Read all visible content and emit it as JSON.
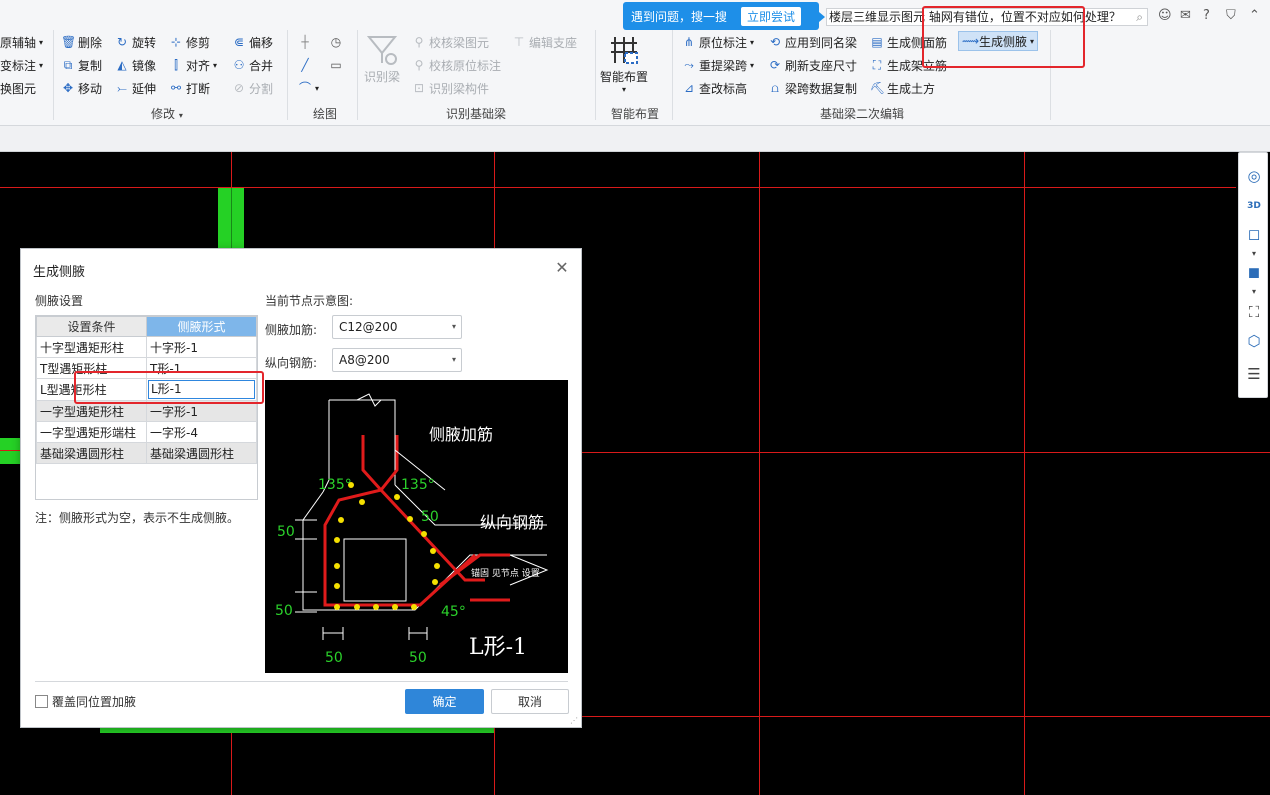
{
  "ribbon": {
    "left_partial": [
      "原辅轴",
      "变标注",
      "换图元"
    ],
    "modify": {
      "items": [
        "删除",
        "旋转",
        "修剪",
        "偏移",
        "复制",
        "镜像",
        "对齐",
        "合并",
        "移动",
        "延伸",
        "打断",
        "分割"
      ],
      "group_label": "修改"
    },
    "draw": {
      "group_label": "绘图"
    },
    "identify_beam": {
      "big_button": "识别梁",
      "items": [
        "校核梁图元",
        "编辑支座",
        "校核原位标注",
        "识别梁构件"
      ],
      "group_label": "识别基础梁"
    },
    "smart_layout": {
      "big_button": "智能布置",
      "group_label": "智能布置"
    },
    "secondary_edit": {
      "items": [
        "原位标注",
        "应用到同名梁",
        "生成侧面筋",
        "生成侧腋",
        "重提梁跨",
        "刷新支座尺寸",
        "生成架立筋",
        "查改标高",
        "梁跨数据复制",
        "生成土方"
      ],
      "group_label": "基础梁二次编辑"
    },
    "notify": {
      "text": "遇到问题，搜一搜",
      "button": "立即尝试"
    },
    "search_text": "楼层三维显示图元 轴网有错位，位置不对应如何处理？"
  },
  "dialog": {
    "title": "生成侧腋",
    "rule_section_label": "侧腋设置",
    "table_headers": [
      "设置条件",
      "侧腋形式"
    ],
    "rows": [
      {
        "condition": "十字型遇矩形柱",
        "form": "十字形-1",
        "grey": false
      },
      {
        "condition": "T型遇矩形柱",
        "form": "T形-1",
        "grey": false
      },
      {
        "condition": "L型遇矩形柱",
        "form": "L形-1",
        "grey": false
      },
      {
        "condition": "一字型遇矩形柱",
        "form": "一字形-1",
        "grey": true
      },
      {
        "condition": "一字型遇矩形端柱",
        "form": "一字形-4",
        "grey": false
      },
      {
        "condition": "基础梁遇圆形柱",
        "form": "基础梁遇圆形柱",
        "grey": true
      }
    ],
    "note": "注：侧腋形式为空，表示不生成侧腋。",
    "diagram_label": "当前节点示意图:",
    "haunch_rebar_label": "侧腋加筋:",
    "haunch_rebar_value": "C12@200",
    "long_rebar_label": "纵向钢筋:",
    "long_rebar_value": "A8@200",
    "diagram_texts": {
      "haunch": "侧腋加筋",
      "long": "纵向钢筋",
      "anchor": "锚固 见节点 设置",
      "a135": "135°",
      "a45": "45°",
      "d50": "50",
      "form_name": "L形-1"
    },
    "overwrite_label": "覆盖同位置加腋",
    "ok": "确定",
    "cancel": "取消"
  },
  "colors": {
    "accent": "#2f86d9",
    "highlight": "#e3262c",
    "axis": "#d91a1a",
    "element": "#25d125"
  }
}
